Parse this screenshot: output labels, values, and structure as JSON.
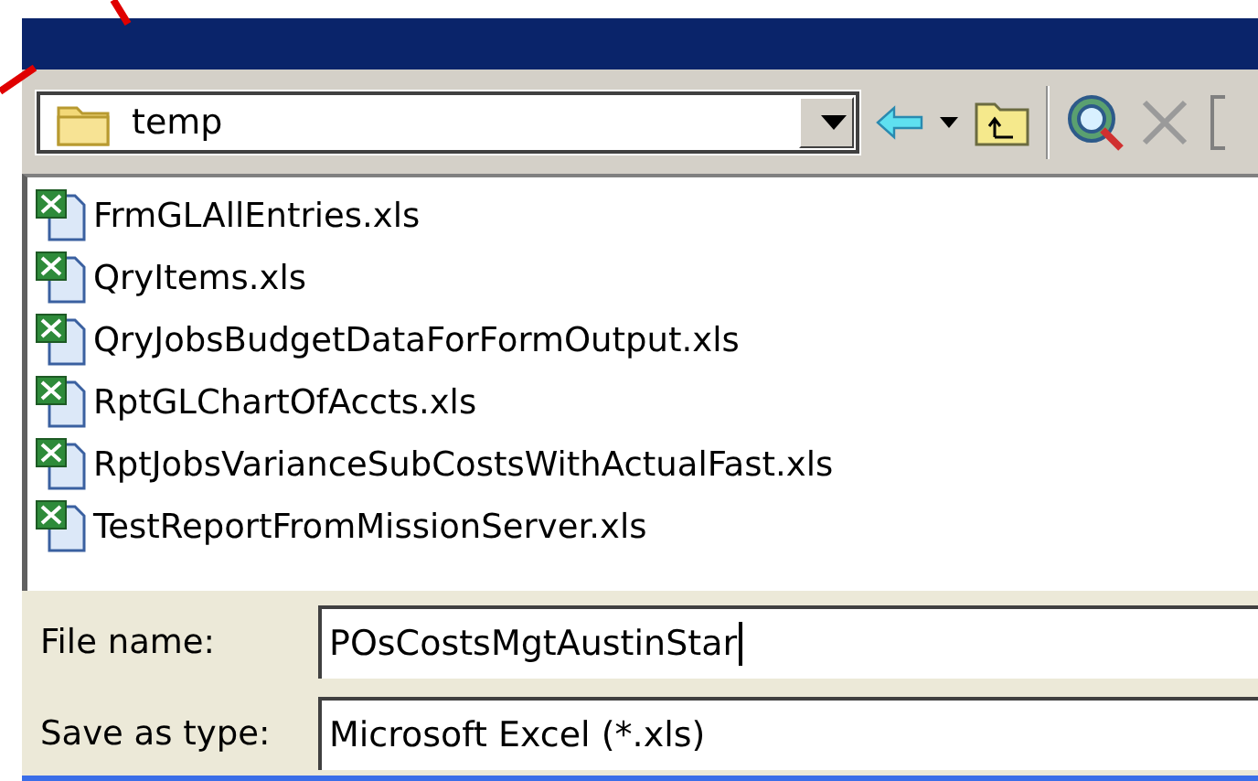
{
  "location": {
    "value": "temp"
  },
  "files": [
    {
      "name": "FrmGLAllEntries.xls"
    },
    {
      "name": "QryItems.xls"
    },
    {
      "name": "QryJobsBudgetDataForFormOutput.xls"
    },
    {
      "name": "RptGLChartOfAccts.xls"
    },
    {
      "name": "RptJobsVarianceSubCostsWithActualFast.xls"
    },
    {
      "name": "TestReportFromMissionServer.xls"
    }
  ],
  "fields": [
    {
      "label": "File name:",
      "value": "POsCostsMgtAustinStar"
    },
    {
      "label": "Save as type:",
      "value": "Microsoft Excel (*.xls)"
    }
  ]
}
